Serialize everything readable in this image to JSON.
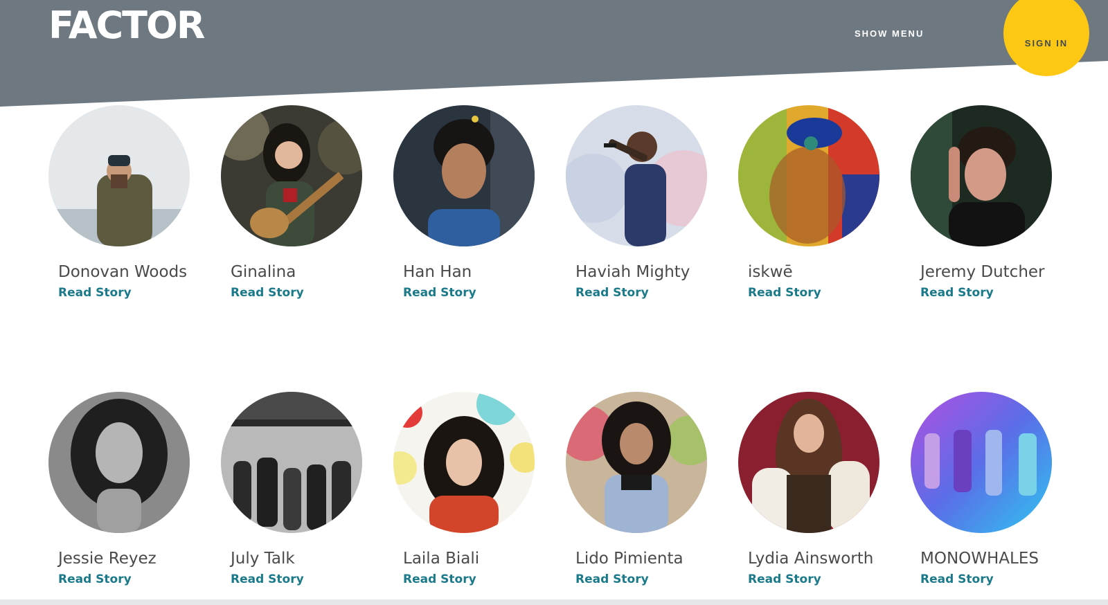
{
  "header": {
    "logo": "FACTOR",
    "show_menu": "SHOW MENU",
    "sign_in": "SIGN IN",
    "colors": {
      "band": "#6d7880",
      "sign_in_bg": "#fcc813",
      "link": "#1b7a8a"
    }
  },
  "artists": [
    {
      "name": "Donovan Woods",
      "link": "Read Story",
      "photo_tone": "#cfd6da"
    },
    {
      "name": "Ginalina",
      "link": "Read Story",
      "photo_tone": "#4e4a3f"
    },
    {
      "name": "Han Han",
      "link": "Read Story",
      "photo_tone": "#2d3a4a"
    },
    {
      "name": "Haviah Mighty",
      "link": "Read Story",
      "photo_tone": "#c6cde0"
    },
    {
      "name": "iskwē",
      "link": "Read Story",
      "photo_tone": "#d9a030"
    },
    {
      "name": "Jeremy Dutcher",
      "link": "Read Story",
      "photo_tone": "#1f2a25"
    },
    {
      "name": "Jessie Reyez",
      "link": "Read Story",
      "photo_tone": "#6a6a6a"
    },
    {
      "name": "July Talk",
      "link": "Read Story",
      "photo_tone": "#8f8f8f"
    },
    {
      "name": "Laila Biali",
      "link": "Read Story",
      "photo_tone": "#f2f0ea"
    },
    {
      "name": "Lido Pimienta",
      "link": "Read Story",
      "photo_tone": "#b9a28e"
    },
    {
      "name": "Lydia Ainsworth",
      "link": "Read Story",
      "photo_tone": "#8a2a35"
    },
    {
      "name": "MONOWHALES",
      "link": "Read Story",
      "photo_tone": "#6f5de6"
    }
  ]
}
